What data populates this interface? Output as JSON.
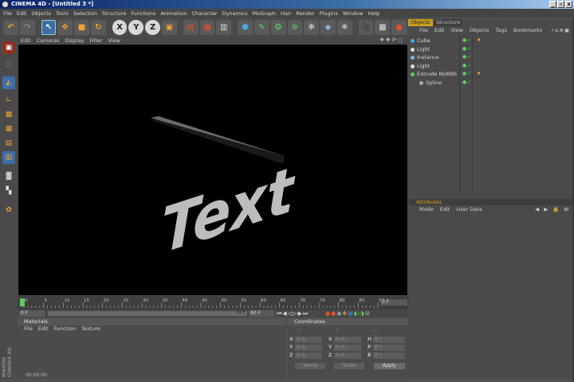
{
  "window": {
    "title": "CINEMA 4D - [Untitled 3 *]",
    "btn_min": "_",
    "btn_max": "▫",
    "btn_close": "x"
  },
  "menu": [
    "File",
    "Edit",
    "Objects",
    "Tools",
    "Selection",
    "Structure",
    "Functions",
    "Animation",
    "Character",
    "Dynamics",
    "MoGraph",
    "Hair",
    "Render",
    "Plugins",
    "Window",
    "Help"
  ],
  "toolbar": {
    "x": "X",
    "y": "Y",
    "z": "Z"
  },
  "viewport": {
    "menu": [
      "Edit",
      "Cameras",
      "Display",
      "Filter",
      "View"
    ],
    "text3d": "Text"
  },
  "timeline": {
    "ticks": [
      "0",
      "5",
      "10",
      "15",
      "20",
      "25",
      "30",
      "35",
      "40",
      "45",
      "50",
      "55",
      "60",
      "65",
      "70",
      "75",
      "80",
      "85",
      "90"
    ],
    "frame_end": "0 F",
    "start_field": "0 F",
    "range_end": "90 F",
    "end_field": "90 F"
  },
  "materials": {
    "title": "Materials",
    "menu": [
      "File",
      "Edit",
      "Function",
      "Texture"
    ]
  },
  "status": {
    "time": "00:00:00"
  },
  "coordinates": {
    "title": "Coordinates",
    "headers": [
      "--",
      "--",
      "--"
    ],
    "rows": [
      {
        "l1": "X",
        "v1": "0 m",
        "l2": "X",
        "v2": "0 m",
        "l3": "H",
        "v3": "0 °"
      },
      {
        "l1": "Y",
        "v1": "0 m",
        "l2": "Y",
        "v2": "0 m",
        "l3": "P",
        "v3": "0 °"
      },
      {
        "l1": "Z",
        "v1": "0 m",
        "l2": "Z",
        "v2": "0 m",
        "l3": "B",
        "v3": "0 °"
      }
    ],
    "mode_world": "World",
    "mode_scale": "Scale",
    "apply": "Apply"
  },
  "objects_panel": {
    "tabs": [
      "Objects",
      "Structure"
    ],
    "menu": [
      "File",
      "Edit",
      "View",
      "Objects",
      "Tags",
      "Bookmarks"
    ],
    "items": [
      {
        "name": "Cube",
        "color": "#4aa8e0"
      },
      {
        "name": "Light",
        "color": "#e0e0e0"
      },
      {
        "name": "Instance",
        "color": "#8ab4d4"
      },
      {
        "name": "Light",
        "color": "#e0e0e0"
      },
      {
        "name": "Extrude NURBS",
        "color": "#5ad05a"
      },
      {
        "name": "Spline",
        "color": "#aaaaaa"
      }
    ]
  },
  "attributes_panel": {
    "title": "Attributes",
    "menu": [
      "Mode",
      "Edit",
      "User Data"
    ]
  }
}
